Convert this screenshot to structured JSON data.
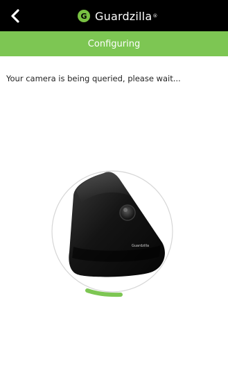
{
  "header": {
    "back_icon": "chevron-left-icon",
    "brand_logo_letter": "G",
    "brand_name": "Guardzilla",
    "brand_mark": "®",
    "background": "#000000"
  },
  "status": {
    "title": "Configuring",
    "background": "#7dc653"
  },
  "content": {
    "message": "Your camera is being queried, please wait...",
    "camera_label": "Guardzilla",
    "progress_accent": "#7dc653",
    "progress_fraction": 0.15
  }
}
